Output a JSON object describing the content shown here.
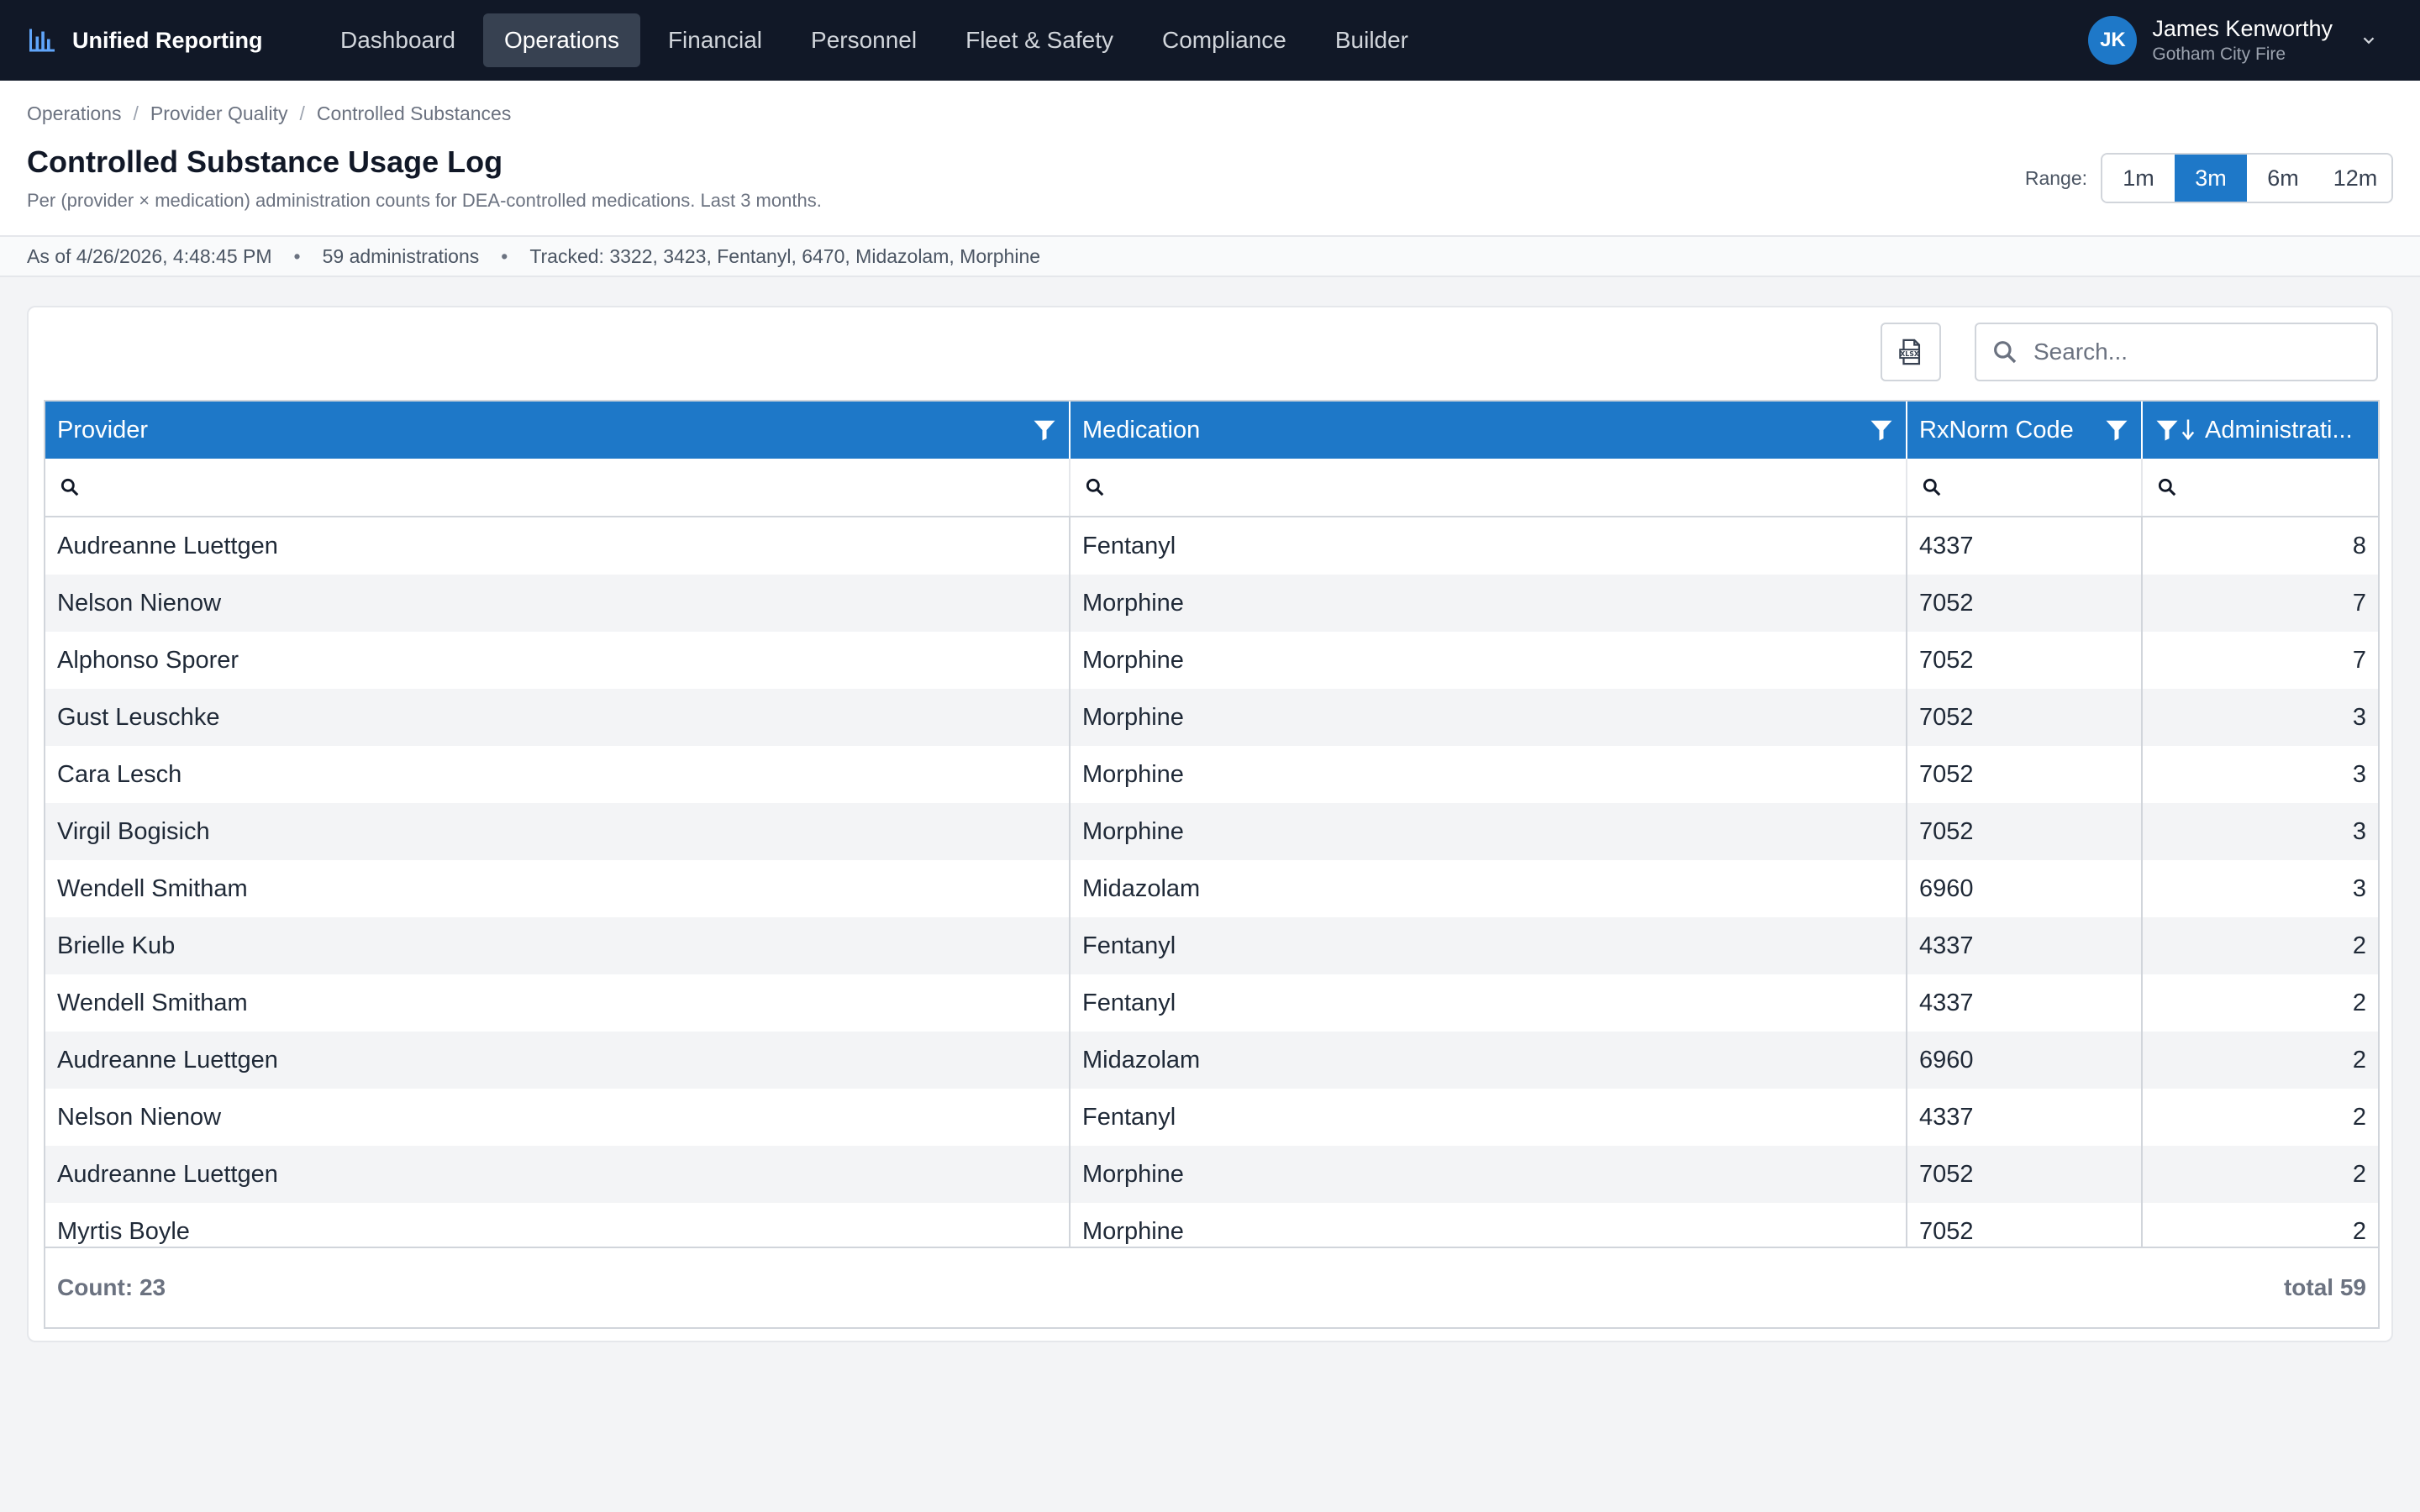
{
  "app": {
    "name": "Unified Reporting"
  },
  "nav": {
    "items": [
      {
        "label": "Dashboard",
        "active": false
      },
      {
        "label": "Operations",
        "active": true
      },
      {
        "label": "Financial",
        "active": false
      },
      {
        "label": "Personnel",
        "active": false
      },
      {
        "label": "Fleet & Safety",
        "active": false
      },
      {
        "label": "Compliance",
        "active": false
      },
      {
        "label": "Builder",
        "active": false
      }
    ]
  },
  "user": {
    "initials": "JK",
    "name": "James Kenworthy",
    "org": "Gotham City Fire"
  },
  "breadcrumb": [
    "Operations",
    "Provider Quality",
    "Controlled Substances"
  ],
  "page": {
    "title": "Controlled Substance Usage Log",
    "subtitle": "Per (provider × medication) administration counts for DEA-controlled medications. Last 3 months."
  },
  "range": {
    "label": "Range:",
    "options": [
      "1m",
      "3m",
      "6m",
      "12m"
    ],
    "selected": "3m"
  },
  "status": {
    "as_of": "As of 4/26/2026, 4:48:45 PM",
    "dot": "•",
    "count": "59 administrations",
    "tracked": "Tracked: 3322, 3423, Fentanyl, 6470, Midazolam, Morphine"
  },
  "toolbar": {
    "search_placeholder": "Search..."
  },
  "table": {
    "columns": [
      "Provider",
      "Medication",
      "RxNorm Code",
      "Administrati..."
    ],
    "rows": [
      [
        "Audreanne Luettgen",
        "Fentanyl",
        "4337",
        "8"
      ],
      [
        "Nelson Nienow",
        "Morphine",
        "7052",
        "7"
      ],
      [
        "Alphonso Sporer",
        "Morphine",
        "7052",
        "7"
      ],
      [
        "Gust Leuschke",
        "Morphine",
        "7052",
        "3"
      ],
      [
        "Cara Lesch",
        "Morphine",
        "7052",
        "3"
      ],
      [
        "Virgil Bogisich",
        "Morphine",
        "7052",
        "3"
      ],
      [
        "Wendell Smitham",
        "Midazolam",
        "6960",
        "3"
      ],
      [
        "Brielle Kub",
        "Fentanyl",
        "4337",
        "2"
      ],
      [
        "Wendell Smitham",
        "Fentanyl",
        "4337",
        "2"
      ],
      [
        "Audreanne Luettgen",
        "Midazolam",
        "6960",
        "2"
      ],
      [
        "Nelson Nienow",
        "Fentanyl",
        "4337",
        "2"
      ],
      [
        "Audreanne Luettgen",
        "Morphine",
        "7052",
        "2"
      ],
      [
        "Myrtis Boyle",
        "Morphine",
        "7052",
        "2"
      ]
    ],
    "footer_count": "Count: 23",
    "footer_total": "total 59"
  },
  "colors": {
    "accent": "#1e78c8",
    "topbar": "#111827"
  },
  "icons": [
    "bar-chart-icon",
    "chevron-down-icon",
    "xlsx-export-icon",
    "search-icon",
    "filter-icon",
    "sort-desc-icon"
  ]
}
